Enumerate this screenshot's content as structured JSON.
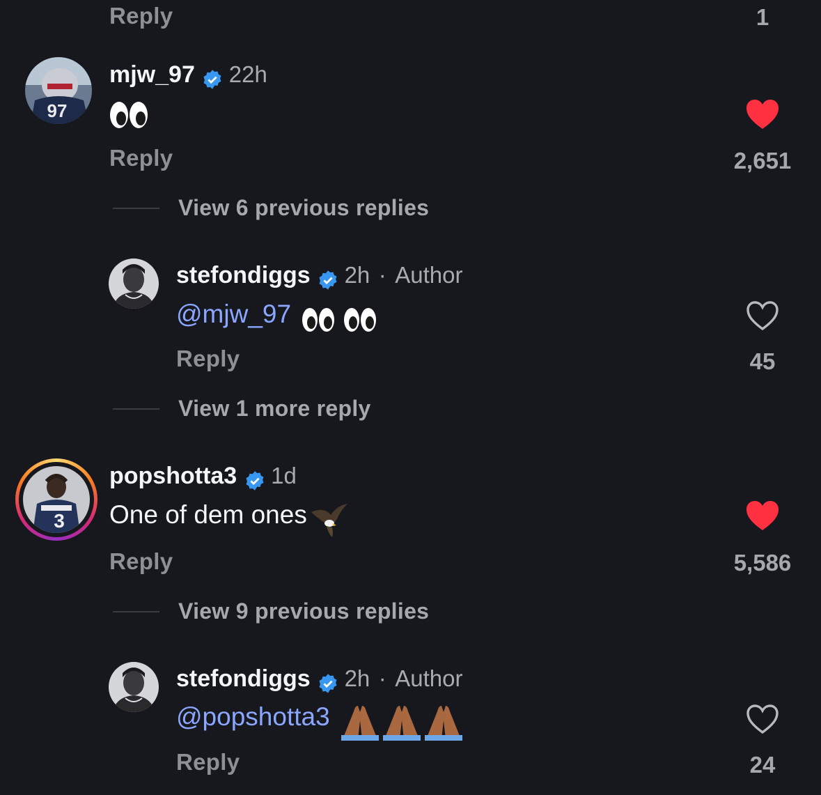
{
  "top": {
    "reply_label": "Reply",
    "like_count": "1"
  },
  "comments": [
    {
      "username": "mjw_97",
      "time": "22h",
      "author_tag": "",
      "text": "",
      "mention": "",
      "emoji": "eyes",
      "liked": true,
      "like_count": "2,651",
      "reply_label": "Reply",
      "view_more": "View 6 previous replies"
    },
    {
      "username": "stefondiggs",
      "time": "2h",
      "author_tag": "Author",
      "mention": "@mjw_97",
      "emoji": "eyes eyes",
      "liked": false,
      "like_count": "45",
      "reply_label": "Reply",
      "view_more": "View 1 more reply"
    },
    {
      "username": "popshotta3",
      "time": "1d",
      "author_tag": "",
      "text": "One of dem ones",
      "emoji": "eagle",
      "liked": true,
      "like_count": "5,586",
      "reply_label": "Reply",
      "view_more": "View 9 previous replies"
    },
    {
      "username": "stefondiggs",
      "time": "2h",
      "author_tag": "Author",
      "mention": "@popshotta3",
      "emoji": "folded-hands x3",
      "liked": false,
      "like_count": "24",
      "reply_label": "Reply"
    }
  ],
  "separator": "·",
  "colors": {
    "background": "#16181d",
    "heart_red": "#ff3040",
    "verified_blue": "#3897f0",
    "mention_blue": "#8aa6ff",
    "story_ring": [
      "#feda75",
      "#d62976",
      "#962fbf"
    ]
  }
}
